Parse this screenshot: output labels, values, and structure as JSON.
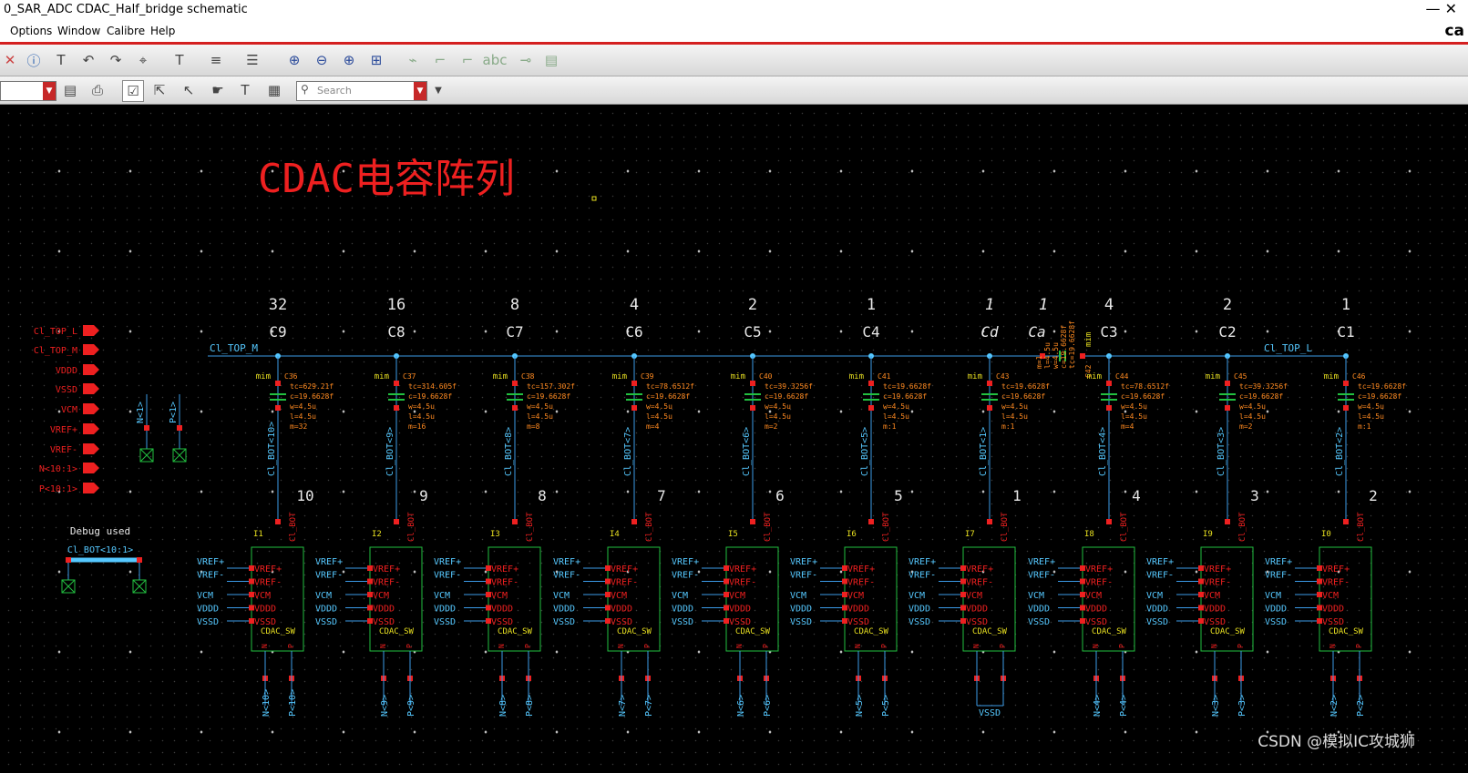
{
  "window": {
    "title": "0_SAR_ADC CDAC_Half_bridge schematic",
    "brand": "ca",
    "controls": "—  ✕"
  },
  "menu": [
    {
      "label": "Options"
    },
    {
      "label": "Window"
    },
    {
      "label": "Calibre"
    },
    {
      "label": "Help"
    }
  ],
  "toolbar": {
    "search_placeholder": "Search"
  },
  "icons": {
    "toolbar1": [
      "delete-icon",
      "info-icon",
      "text-icon",
      "undo-icon",
      "redo-icon",
      "stretch-icon",
      "font-icon",
      "align-icon",
      "distribute-icon",
      "zoom-fit-icon",
      "zoom-out-icon",
      "zoom-in-icon",
      "zoom-select-icon",
      "add-wire-icon",
      "net-icon",
      "pin-icon",
      "label-icon",
      "bus-icon",
      "properties-icon"
    ],
    "toolbar2": [
      "save-icon",
      "print-icon",
      "select-all-icon",
      "select-icon",
      "pointer-icon",
      "hand-icon",
      "text-select-icon",
      "search-icon",
      "dropdown-icon"
    ]
  },
  "canvas": {
    "title": "CDAC电容阵列",
    "net_left": "Cl_TOP_M",
    "net_right": "Cl_TOP_L",
    "cap_type": "mim",
    "vssd_label": "VSSD",
    "debug_label": "Debug used",
    "debug_bus": "Cl_BOT<10:1>",
    "pins": [
      {
        "label": "Cl_TOP_L",
        "color": "#ee2020"
      },
      {
        "label": "Cl_TOP_M",
        "color": "#ee2020"
      },
      {
        "label": "VDDD",
        "color": "#ee2020"
      },
      {
        "label": "VSSD",
        "color": "#ee2020"
      },
      {
        "label": "VCM",
        "color": "#ee2020"
      },
      {
        "label": "VREF+",
        "color": "#ee2020"
      },
      {
        "label": "VREF-",
        "color": "#ee2020"
      },
      {
        "label": "N<10:1>",
        "color": "#ee2020"
      },
      {
        "label": "P<10:1>",
        "color": "#ee2020"
      }
    ],
    "terminals": [
      {
        "label": "N<1>"
      },
      {
        "label": "P<1>"
      }
    ],
    "capacitors": [
      {
        "weight": "32",
        "name": "C9",
        "inst": "C36",
        "tc": "tc=629.21f",
        "c": "c=19.6628f",
        "w": "w=4.5u",
        "l": "l=4.5u",
        "m": "m=32",
        "bot": "Cl_BOT<10>",
        "bit": "10"
      },
      {
        "weight": "16",
        "name": "C8",
        "inst": "C37",
        "tc": "tc=314.605f",
        "c": "c=19.6628f",
        "w": "w=4.5u",
        "l": "l=4.5u",
        "m": "m=16",
        "bot": "Cl_BOT<9>",
        "bit": "9"
      },
      {
        "weight": "8",
        "name": "C7",
        "inst": "C38",
        "tc": "tc=157.302f",
        "c": "c=19.6628f",
        "w": "w=4.5u",
        "l": "l=4.5u",
        "m": "m=8",
        "bot": "Cl_BOT<8>",
        "bit": "8"
      },
      {
        "weight": "4",
        "name": "C6",
        "inst": "C39",
        "tc": "tc=78.6512f",
        "c": "c=19.6628f",
        "w": "w=4.5u",
        "l": "l=4.5u",
        "m": "m=4",
        "bot": "Cl_BOT<7>",
        "bit": "7"
      },
      {
        "weight": "2",
        "name": "C5",
        "inst": "C40",
        "tc": "tc=39.3256f",
        "c": "c=19.6628f",
        "w": "w=4.5u",
        "l": "l=4.5u",
        "m": "m=2",
        "bot": "Cl_BOT<6>",
        "bit": "6"
      },
      {
        "weight": "1",
        "name": "C4",
        "inst": "C41",
        "tc": "tc=19.6628f",
        "c": "c=19.6628f",
        "w": "w=4.5u",
        "l": "l=4.5u",
        "m": "m:1",
        "bot": "Cl_BOT<5>",
        "bit": "5"
      },
      {
        "weight": "1",
        "name": "Cd",
        "inst": "C43",
        "tc": "tc=19.6628f",
        "c": "c=19.6628f",
        "w": "w=4.5u",
        "l": "l=4.5u",
        "m": "m:1",
        "bot": "Cl_BOT<1>",
        "bit": "1"
      },
      {
        "weight": "4",
        "name": "C3",
        "inst": "C44",
        "tc": "tc=78.6512f",
        "c": "c=19.6628f",
        "w": "w=4.5u",
        "l": "l=4.5u",
        "m": "m=4",
        "bot": "Cl_BOT<4>",
        "bit": "4"
      },
      {
        "weight": "2",
        "name": "C2",
        "inst": "C45",
        "tc": "tc=39.3256f",
        "c": "c=19.6628f",
        "w": "w=4.5u",
        "l": "l=4.5u",
        "m": "m=2",
        "bot": "Cl_BOT<3>",
        "bit": "3"
      },
      {
        "weight": "1",
        "name": "C1",
        "inst": "C46",
        "tc": "tc=19.6628f",
        "c": "c=19.6628f",
        "w": "w=4.5u",
        "l": "l=4.5u",
        "m": "m:1",
        "bot": "Cl_BOT<2>",
        "bit": "2"
      }
    ],
    "ca": {
      "weight": "1",
      "name": "Ca",
      "inst": "C42",
      "props": [
        "m=1",
        "l=4.5u",
        "w=4.5u",
        "c=19.6628f",
        "tc=19.6628f"
      ]
    },
    "switches": [
      {
        "inst": "I1",
        "n": "N<10>",
        "p": "P<10>"
      },
      {
        "inst": "I2",
        "n": "N<9>",
        "p": "P<9>"
      },
      {
        "inst": "I3",
        "n": "N<8>",
        "p": "P<8>"
      },
      {
        "inst": "I4",
        "n": "N<7>",
        "p": "P<7>"
      },
      {
        "inst": "I5",
        "n": "N<6>",
        "p": "P<6>"
      },
      {
        "inst": "I6",
        "n": "N<5>",
        "p": "P<5>"
      },
      {
        "inst": "I7",
        "n": "",
        "p": ""
      },
      {
        "inst": "I8",
        "n": "N<4>",
        "p": "P<4>"
      },
      {
        "inst": "I9",
        "n": "N<3>",
        "p": "P<3>"
      },
      {
        "inst": "I0",
        "n": "N<2>",
        "p": "P<2>"
      }
    ],
    "switch_pins": [
      "VREF+",
      "VREF-",
      "VCM",
      "VDDD",
      "VSSD"
    ],
    "switch_cell": "CDAC_SW",
    "switch_top_pin": "Cl_BOT",
    "switch_bottom_pins": [
      "N",
      "P"
    ]
  },
  "watermark": "CSDN @模拟IC攻城狮"
}
